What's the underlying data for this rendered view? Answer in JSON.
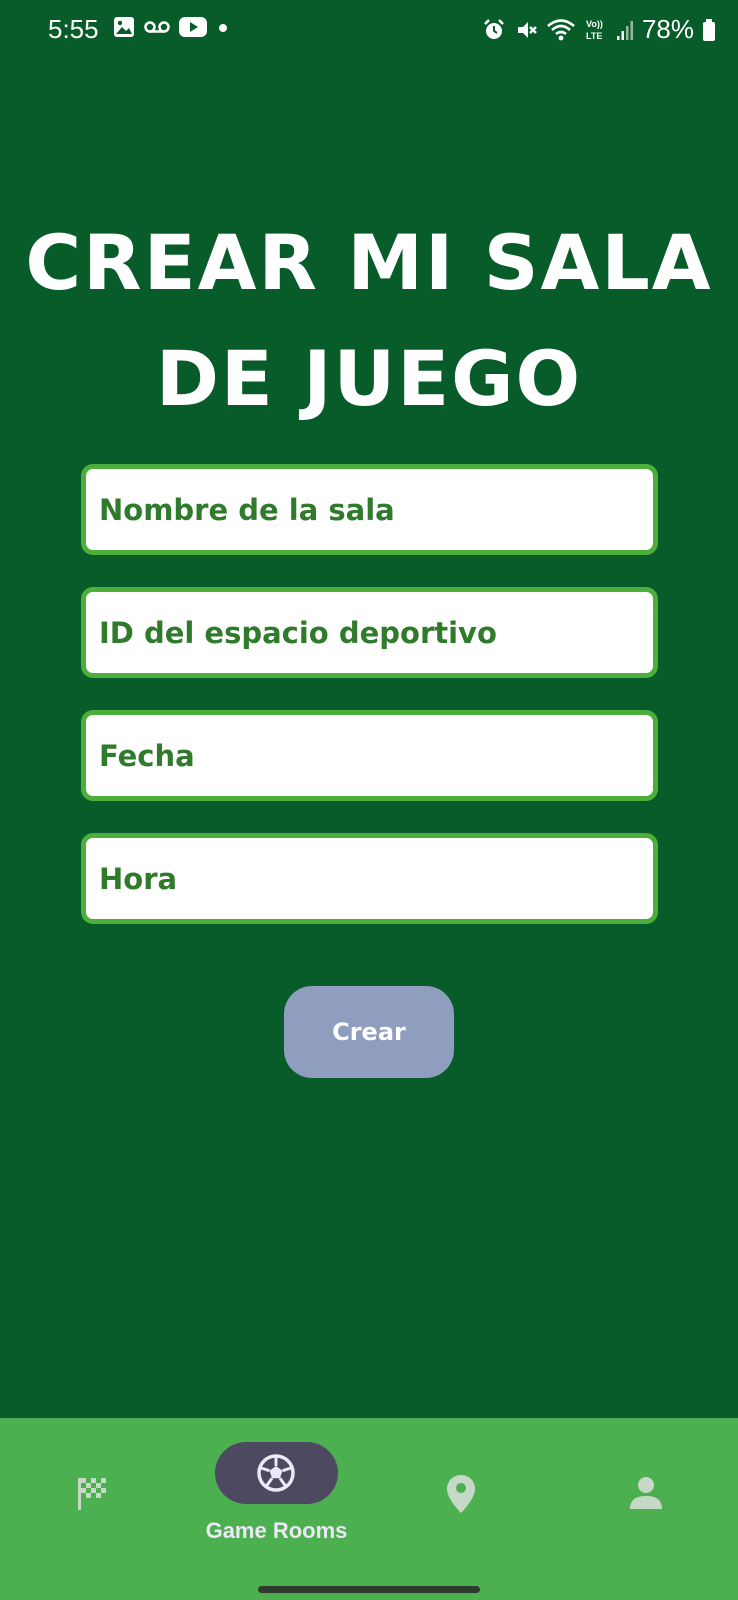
{
  "status_bar": {
    "time": "5:55",
    "battery_percent": "78%",
    "left_icons": [
      "image-icon",
      "voicemail-icon",
      "youtube-icon",
      "dot-icon"
    ],
    "right_icons": [
      "alarm-icon",
      "vibrate-icon",
      "wifi-icon",
      "volte-icon",
      "signal-icon",
      "battery-icon"
    ]
  },
  "page": {
    "title_line1": "CREAR MI SALA",
    "title_line2": "DE JUEGO"
  },
  "form": {
    "room_name": {
      "placeholder": "Nombre de la sala",
      "value": ""
    },
    "sport_space_id": {
      "placeholder": "ID del espacio deportivo",
      "value": ""
    },
    "date": {
      "placeholder": "Fecha",
      "value": ""
    },
    "time": {
      "placeholder": "Hora",
      "value": ""
    },
    "submit_label": "Crear"
  },
  "bottom_nav": {
    "items": [
      {
        "icon": "checkered-flag-icon",
        "label": ""
      },
      {
        "icon": "soccer-ball-icon",
        "label": "Game Rooms",
        "selected": true
      },
      {
        "icon": "location-pin-icon",
        "label": ""
      },
      {
        "icon": "person-icon",
        "label": ""
      }
    ]
  },
  "colors": {
    "background": "#075c2a",
    "field_border": "#4caf3b",
    "field_text": "#2f7a2b",
    "button": "#8f9dbf",
    "nav_bar": "#4caf50",
    "nav_pill": "#4c4960"
  }
}
